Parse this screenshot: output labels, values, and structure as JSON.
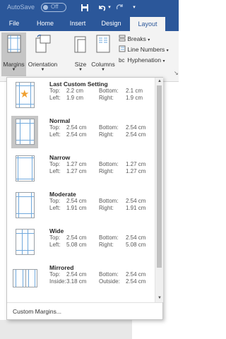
{
  "titlebar": {
    "autosave_label": "AutoSave",
    "autosave_state": "Off",
    "icons": [
      "save-icon",
      "undo-icon",
      "redo-icon",
      "customize-qat-icon"
    ]
  },
  "tabs": [
    {
      "label": "File",
      "active": false
    },
    {
      "label": "Home",
      "active": false
    },
    {
      "label": "Insert",
      "active": false
    },
    {
      "label": "Design",
      "active": false
    },
    {
      "label": "Layout",
      "active": true
    }
  ],
  "ribbon": {
    "margins": "Margins",
    "orientation": "Orientation",
    "size": "Size",
    "columns": "Columns",
    "breaks": "Breaks",
    "line_numbers": "Line Numbers",
    "hyphenation": "Hyphenation"
  },
  "margins_menu": {
    "items": [
      {
        "name": "Last Custom Setting",
        "k1": "Top:",
        "v1": "2.2 cm",
        "k2": "Bottom:",
        "v2": "2.1 cm",
        "k3": "Left:",
        "v3": "1.9 cm",
        "k4": "Right:",
        "v4": "1.9 cm",
        "icon": "star-icon"
      },
      {
        "name": "Normal",
        "k1": "Top:",
        "v1": "2.54 cm",
        "k2": "Bottom:",
        "v2": "2.54 cm",
        "k3": "Left:",
        "v3": "2.54 cm",
        "k4": "Right:",
        "v4": "2.54 cm"
      },
      {
        "name": "Narrow",
        "k1": "Top:",
        "v1": "1.27 cm",
        "k2": "Bottom:",
        "v2": "1.27 cm",
        "k3": "Left:",
        "v3": "1.27 cm",
        "k4": "Right:",
        "v4": "1.27 cm"
      },
      {
        "name": "Moderate",
        "k1": "Top:",
        "v1": "2.54 cm",
        "k2": "Bottom:",
        "v2": "2.54 cm",
        "k3": "Left:",
        "v3": "1.91 cm",
        "k4": "Right:",
        "v4": "1.91 cm"
      },
      {
        "name": "Wide",
        "k1": "Top:",
        "v1": "2.54 cm",
        "k2": "Bottom:",
        "v2": "2.54 cm",
        "k3": "Left:",
        "v3": "5.08 cm",
        "k4": "Right:",
        "v4": "5.08 cm"
      },
      {
        "name": "Mirrored",
        "k1": "Top:",
        "v1": "2.54 cm",
        "k2": "Bottom:",
        "v2": "2.54 cm",
        "k3": "Inside:",
        "v3": "3.18 cm",
        "k4": "Outside:",
        "v4": "2.54 cm"
      }
    ],
    "selected": "Normal",
    "custom_margins": "Custom Margins..."
  },
  "colors": {
    "ribbon_accent": "#2b579a",
    "gridline": "#6fa8dc",
    "selected_bg": "#c6c6c6"
  }
}
